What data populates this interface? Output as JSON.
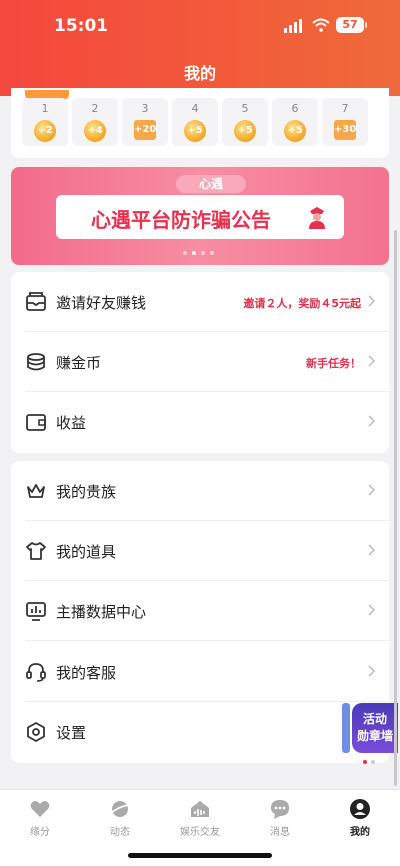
{
  "status": {
    "time": "15:01",
    "battery": "57"
  },
  "header": {
    "title": "我的"
  },
  "checkin": {
    "days": [
      {
        "day": "1",
        "reward": "+2",
        "kind": "coin"
      },
      {
        "day": "2",
        "reward": "+4",
        "kind": "coin"
      },
      {
        "day": "3",
        "reward": "+20",
        "kind": "gift"
      },
      {
        "day": "4",
        "reward": "+5",
        "kind": "coin"
      },
      {
        "day": "5",
        "reward": "+5",
        "kind": "coin"
      },
      {
        "day": "6",
        "reward": "+5",
        "kind": "coin"
      },
      {
        "day": "7",
        "reward": "+30",
        "kind": "gift"
      }
    ]
  },
  "banner": {
    "logo": "心遇",
    "text": "心遇平台防诈骗公告"
  },
  "menu_group1": [
    {
      "label": "邀请好友赚钱",
      "extra": "邀请２人，奖励４5元起",
      "icon": "invite-icon"
    },
    {
      "label": "赚金币",
      "extra": "新手任务！",
      "icon": "coins-icon"
    },
    {
      "label": "收益",
      "extra": "",
      "icon": "wallet-icon"
    }
  ],
  "menu_group2": [
    {
      "label": "我的贵族",
      "icon": "crown-icon"
    },
    {
      "label": "我的道具",
      "icon": "tshirt-icon"
    },
    {
      "label": "主播数据中心",
      "icon": "data-center-icon"
    },
    {
      "label": "我的客服",
      "icon": "headset-icon"
    },
    {
      "label": "设置",
      "icon": "settings-icon"
    }
  ],
  "floating": {
    "line1": "活动",
    "line2": "勋章墙"
  },
  "tabbar": [
    {
      "label": "缘分",
      "icon": "heart-icon"
    },
    {
      "label": "动态",
      "icon": "planet-icon"
    },
    {
      "label": "娱乐交友",
      "icon": "voice-room-icon"
    },
    {
      "label": "消息",
      "icon": "message-icon"
    },
    {
      "label": "我的",
      "icon": "profile-icon",
      "active": true
    }
  ],
  "colors": {
    "accent": "#f4473e",
    "highlight": "#e0314b"
  }
}
